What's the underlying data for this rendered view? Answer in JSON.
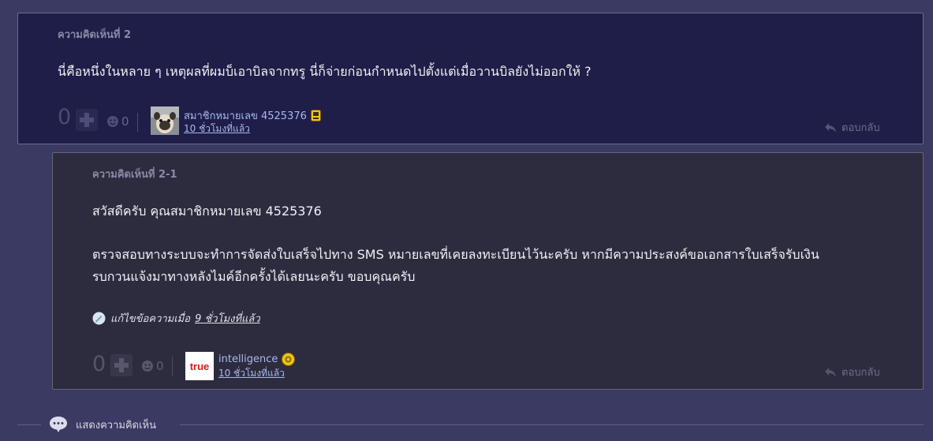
{
  "comment_main": {
    "number_label": "ความคิดเห็นที่ 2",
    "body": "นี่คือหนึ่งในหลาย ๆ เหตุผลที่ผมบ็เอาบิลจากทรู นี่ก็จ่ายก่อนกำหนดไปตั้งแต่เมื่อวานบิลยังไม่ออกให้ ?",
    "vote_count": "0",
    "emotion_count": "0",
    "user_name": "สมาชิกหมายเลข 4525376",
    "time_ago": "10 ชั่วโมงที่แล้ว",
    "reply_label": "ตอบกลับ"
  },
  "comment_reply": {
    "number_label": "ความคิดเห็นที่ 2-1",
    "greeting": "สวัสดีครับ คุณสมาชิกหมายเลข 4525376",
    "body_line1": "ตรวจสอบทางระบบจะทำการจัดส่งใบเสร็จไปทาง SMS หมายเลขที่เคยลงทะเบียนไว้นะครับ หากมีความประสงค์ขอเอกสารใบเสร็จรับเงิน",
    "body_line2": "รบกวนแจ้งมาทางหลังไมค์อีกครั้งได้เลยนะครับ ขอบคุณครับ",
    "edit_prefix": "แก้ไขข้อความเมื่อ",
    "edit_time": "9 ชั่วโมงที่แล้ว",
    "vote_count": "0",
    "emotion_count": "0",
    "user_name": "intelligence",
    "avatar_text": "true",
    "time_ago": "10 ชั่วโมงที่แล้ว",
    "reply_label": "ตอบกลับ"
  },
  "footer": {
    "show_comments_label": "แสดงความคิดเห็น"
  },
  "colors": {
    "page_bg": "#3b3a63",
    "main_comment_bg": "#1f1e48",
    "reply_bg": "#2d2c3f",
    "link": "#a7b8ec"
  }
}
